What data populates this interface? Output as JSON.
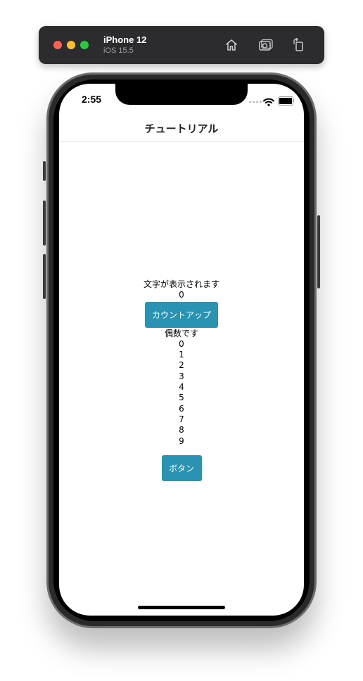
{
  "simulator": {
    "device_name": "iPhone 12",
    "os_version": "iOS 15.5",
    "icons": [
      "home-icon",
      "screenshot-icon",
      "rotate-icon"
    ]
  },
  "status_bar": {
    "time": "2:55"
  },
  "navbar": {
    "title": "チュートリアル"
  },
  "main": {
    "display_text": "文字が表示されます",
    "count_value": "0",
    "count_button_label": "カウントアップ",
    "even_label": "偶数です",
    "numbers": [
      "0",
      "1",
      "2",
      "3",
      "4",
      "5",
      "6",
      "7",
      "8",
      "9"
    ],
    "button_label": "ボタン"
  },
  "colors": {
    "button_bg": "#2a93b3",
    "button_text": "#ffffff"
  }
}
